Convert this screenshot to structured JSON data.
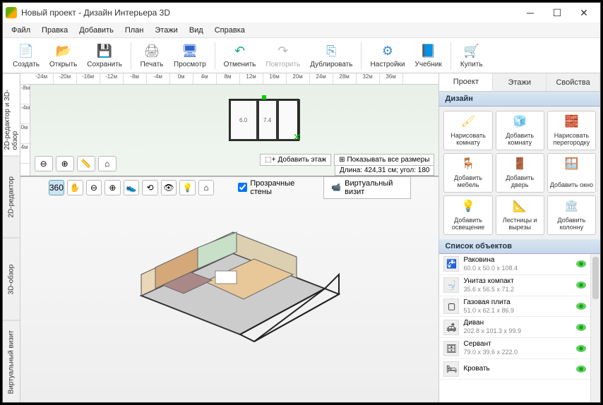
{
  "title": "Новый проект - Дизайн Интерьера 3D",
  "menus": [
    "Файл",
    "Правка",
    "Добавить",
    "План",
    "Этажи",
    "Вид",
    "Справка"
  ],
  "toolbar": [
    {
      "id": "create",
      "label": "Создать",
      "icon": "📄",
      "color": "#fff"
    },
    {
      "id": "open",
      "label": "Открыть",
      "icon": "📂",
      "color": "#fc6"
    },
    {
      "id": "save",
      "label": "Сохранить",
      "icon": "💾",
      "color": "#58c"
    },
    {
      "sep": true
    },
    {
      "id": "print",
      "label": "Печать",
      "icon": "🖨",
      "color": "#888"
    },
    {
      "id": "view",
      "label": "Просмотр",
      "icon": "🖥",
      "color": "#36c"
    },
    {
      "sep": true
    },
    {
      "id": "undo",
      "label": "Отменить",
      "icon": "↶",
      "color": "#1a8"
    },
    {
      "id": "redo",
      "label": "Повторить",
      "icon": "↷",
      "color": "#bbb",
      "dis": true
    },
    {
      "id": "dup",
      "label": "Дублировать",
      "icon": "⎘",
      "color": "#6ad"
    },
    {
      "sep": true
    },
    {
      "id": "settings",
      "label": "Настройки",
      "icon": "⚙",
      "color": "#48c"
    },
    {
      "id": "tutorial",
      "label": "Учебник",
      "icon": "📘",
      "color": "#39d"
    },
    {
      "sep": true
    },
    {
      "id": "buy",
      "label": "Купить",
      "icon": "🛒",
      "color": "#fa0"
    }
  ],
  "vtabs": [
    "2D-редактор и 3D-обзор",
    "2D-редактор",
    "3D-обзор",
    "Виртуальный визит"
  ],
  "ruler_h": [
    "-24м",
    "-20м",
    "-16м",
    "-12м",
    "-8м",
    "-4м",
    "0м",
    "4м",
    "8м",
    "12м",
    "16м",
    "20м",
    "24м",
    "28м",
    "32м",
    "36м"
  ],
  "ruler_v": [
    "-8м",
    "-4м",
    "0м",
    "4м"
  ],
  "rooms2d": [
    {
      "label": "6.0"
    },
    {
      "label": "7.4"
    }
  ],
  "floatbar": {
    "add_floor": "Добавить этаж",
    "show_dims": "Показывать все размеры",
    "info": "Длина: 424,31 см; угол: 180"
  },
  "bottom": {
    "transparent_walls": "Прозрачные стены",
    "virtual_visit": "Виртуальный визит"
  },
  "rtabs": [
    "Проект",
    "Этажи",
    "Свойства"
  ],
  "design_header": "Дизайн",
  "design_buttons": [
    {
      "label": "Нарисовать комнату",
      "icon": "🖌",
      "c": "#fb4"
    },
    {
      "label": "Добавить комнату",
      "icon": "🧊",
      "c": "#fc4"
    },
    {
      "label": "Нарисовать перегородку",
      "icon": "🧱",
      "c": "#c85"
    },
    {
      "label": "Добавить мебель",
      "icon": "🪑",
      "c": "#39c"
    },
    {
      "label": "Добавить дверь",
      "icon": "🚪",
      "c": "#c84"
    },
    {
      "label": "Добавить окно",
      "icon": "🪟",
      "c": "#5bd"
    },
    {
      "label": "Добавить освещение",
      "icon": "💡",
      "c": "#fd5"
    },
    {
      "label": "Лестницы и вырезы",
      "icon": "📐",
      "c": "#d86"
    },
    {
      "label": "Добавить колонну",
      "icon": "🏛",
      "c": "#9bc"
    }
  ],
  "objects_header": "Список объектов",
  "objects": [
    {
      "name": "Раковина",
      "dims": "60.0 x 50.0 x 108.4",
      "icon": "🚰"
    },
    {
      "name": "Унитаз компакт",
      "dims": "35.6 x 56.5 x 71.2",
      "icon": "🚽"
    },
    {
      "name": "Газовая плита",
      "dims": "51.0 x 62.1 x 86.9",
      "icon": "▢"
    },
    {
      "name": "Диван",
      "dims": "202.8 x 101.3 x 99.9",
      "icon": "🛋"
    },
    {
      "name": "Сервант",
      "dims": "79.0 x 39.6 x 222.0",
      "icon": "🗄"
    },
    {
      "name": "Кровать",
      "dims": "",
      "icon": "🛏"
    }
  ]
}
